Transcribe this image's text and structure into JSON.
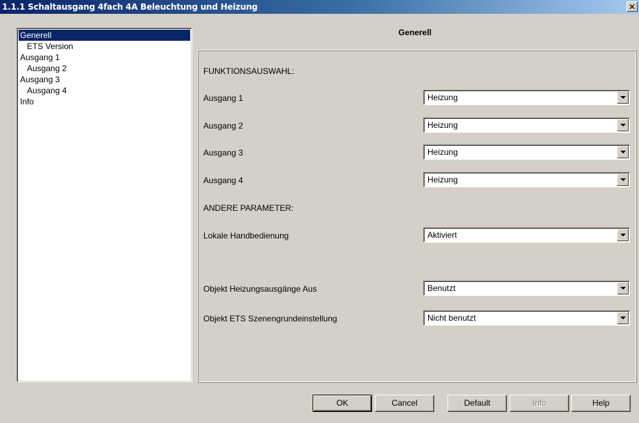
{
  "window": {
    "title": "1.1.1 Schaltausgang 4fach 4A Beleuchtung und Heizung",
    "close_glyph": "✕"
  },
  "tree": {
    "items": [
      {
        "label": "Generell",
        "level": 0,
        "selected": true
      },
      {
        "label": "ETS Version",
        "level": 1,
        "selected": false
      },
      {
        "label": "Ausgang 1",
        "level": 0,
        "selected": false
      },
      {
        "label": "Ausgang 2",
        "level": 1,
        "selected": false
      },
      {
        "label": "Ausgang 3",
        "level": 0,
        "selected": false
      },
      {
        "label": "Ausgang 4",
        "level": 1,
        "selected": false
      },
      {
        "label": "Info",
        "level": 0,
        "selected": false
      }
    ]
  },
  "main": {
    "section_title": "Generell",
    "heading_function": "FUNKTIONSAUSWAHL:",
    "heading_other": "ANDERE PARAMETER:",
    "params": [
      {
        "label": "Ausgang 1",
        "value": "Heizung"
      },
      {
        "label": "Ausgang 2",
        "value": "Heizung"
      },
      {
        "label": "Ausgang 3",
        "value": "Heizung"
      },
      {
        "label": "Ausgang 4",
        "value": "Heizung"
      },
      {
        "label": "Lokale Handbedienung",
        "value": "Aktiviert"
      },
      {
        "label": "Objekt Heizungsausgänge Aus",
        "value": "Benutzt"
      },
      {
        "label": "Objekt ETS Szenengrundeinstellung",
        "value": "Nicht benutzt"
      }
    ]
  },
  "buttons": {
    "ok": "OK",
    "cancel": "Cancel",
    "default": "Default",
    "info": "Info",
    "help": "Help"
  },
  "colors": {
    "titlebar_start": "#0a246a",
    "titlebar_end": "#a6caf0",
    "selection": "#0a246a",
    "face": "#d4d0c8"
  },
  "icons": {
    "close": "close-icon",
    "dropdown": "chevron-down-icon"
  }
}
